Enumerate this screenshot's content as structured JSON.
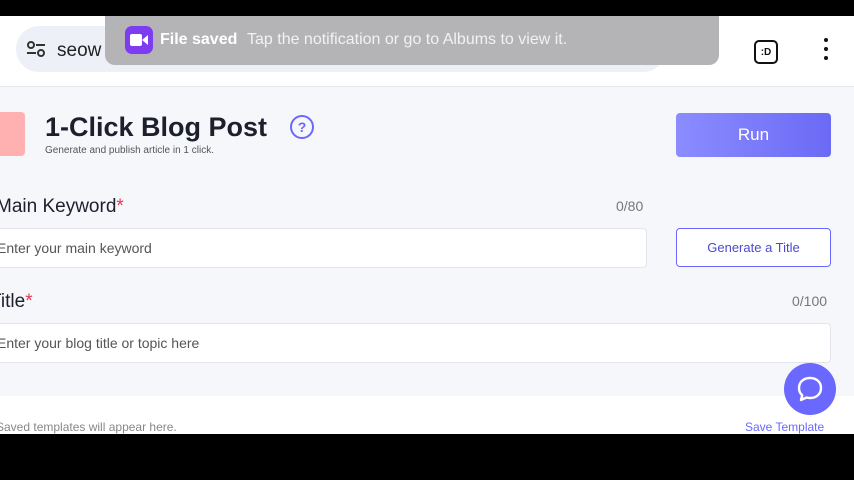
{
  "browser": {
    "url_text": "seow",
    "tab_count": ":D"
  },
  "toast": {
    "title": "File saved",
    "message": "Tap the notification or go to Albums to view it."
  },
  "header": {
    "title": "1-Click Blog Post",
    "subtitle": "Generate and publish article in 1 click.",
    "help": "?",
    "run_label": "Run"
  },
  "fields": {
    "main_keyword": {
      "label": "Main Keyword",
      "required_mark": "*",
      "counter": "0/80",
      "placeholder": "Enter your main keyword"
    },
    "title": {
      "label": "Title",
      "required_mark": "*",
      "counter": "0/100",
      "placeholder": "Enter your blog title or topic here"
    },
    "generate_title_label": "Generate a Title"
  },
  "footer": {
    "templates_note": "Saved templates will appear here.",
    "save_template_label": "Save Template"
  },
  "colors": {
    "accent": "#6b68ff",
    "required": "#e53950",
    "toast_icon": "#7d3cf0"
  }
}
